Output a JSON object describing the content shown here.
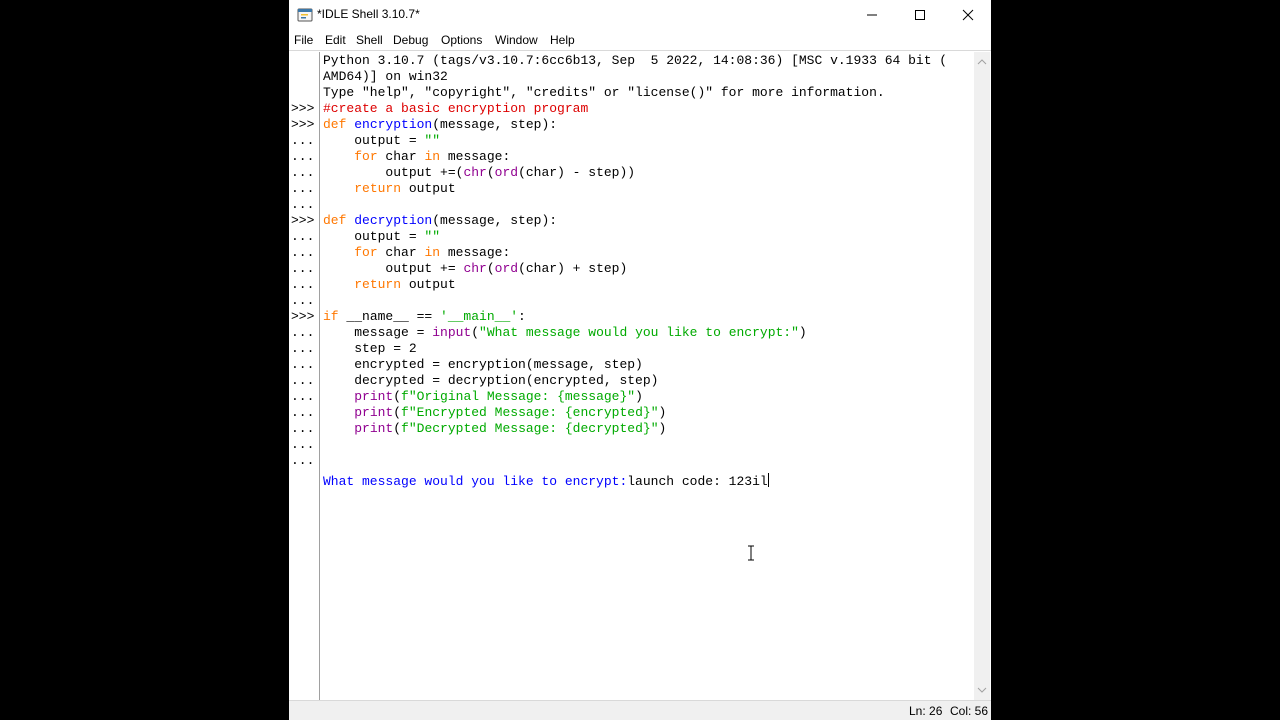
{
  "window": {
    "title": "*IDLE Shell 3.10.7*",
    "controls": [
      "minimize",
      "maximize",
      "close"
    ]
  },
  "menu": [
    "File",
    "Edit",
    "Shell",
    "Debug",
    "Options",
    "Window",
    "Help"
  ],
  "shell": {
    "banner": [
      "Python 3.10.7 (tags/v3.10.7:6cc6b13, Sep  5 2022, 14:08:36) [MSC v.1933 64 bit (",
      "AMD64)] on win32",
      "Type \"help\", \"copyright\", \"credits\" or \"license()\" for more information."
    ],
    "prompts": [
      ">>>",
      ">>>",
      "...",
      "...",
      "...",
      "...",
      "...",
      ">>>",
      "...",
      "...",
      "...",
      "...",
      "...",
      ">>>",
      "...",
      "...",
      "...",
      "...",
      "...",
      "...",
      "...",
      "...",
      "..."
    ],
    "code_lines": [
      [
        {
          "t": "#create a basic encryption program",
          "c": "cm"
        }
      ],
      [
        {
          "t": "def ",
          "c": "kw"
        },
        {
          "t": "encryption",
          "c": "def"
        },
        {
          "t": "(message, step):",
          "c": "plain"
        }
      ],
      [
        {
          "t": "    output = ",
          "c": "plain"
        },
        {
          "t": "\"\"",
          "c": "str"
        }
      ],
      [
        {
          "t": "    ",
          "c": "plain"
        },
        {
          "t": "for",
          "c": "kw"
        },
        {
          "t": " char ",
          "c": "plain"
        },
        {
          "t": "in",
          "c": "kw"
        },
        {
          "t": " message:",
          "c": "plain"
        }
      ],
      [
        {
          "t": "        output +=(",
          "c": "plain"
        },
        {
          "t": "chr",
          "c": "bi"
        },
        {
          "t": "(",
          "c": "plain"
        },
        {
          "t": "ord",
          "c": "bi"
        },
        {
          "t": "(char) - step))",
          "c": "plain"
        }
      ],
      [
        {
          "t": "    ",
          "c": "plain"
        },
        {
          "t": "return",
          "c": "kw"
        },
        {
          "t": " output",
          "c": "plain"
        }
      ],
      [
        {
          "t": "",
          "c": "plain"
        }
      ],
      [
        {
          "t": "def ",
          "c": "kw"
        },
        {
          "t": "decryption",
          "c": "def"
        },
        {
          "t": "(message, step):",
          "c": "plain"
        }
      ],
      [
        {
          "t": "    output = ",
          "c": "plain"
        },
        {
          "t": "\"\"",
          "c": "str"
        }
      ],
      [
        {
          "t": "    ",
          "c": "plain"
        },
        {
          "t": "for",
          "c": "kw"
        },
        {
          "t": " char ",
          "c": "plain"
        },
        {
          "t": "in",
          "c": "kw"
        },
        {
          "t": " message:",
          "c": "plain"
        }
      ],
      [
        {
          "t": "        output += ",
          "c": "plain"
        },
        {
          "t": "chr",
          "c": "bi"
        },
        {
          "t": "(",
          "c": "plain"
        },
        {
          "t": "ord",
          "c": "bi"
        },
        {
          "t": "(char) + step)",
          "c": "plain"
        }
      ],
      [
        {
          "t": "    ",
          "c": "plain"
        },
        {
          "t": "return",
          "c": "kw"
        },
        {
          "t": " output",
          "c": "plain"
        }
      ],
      [
        {
          "t": "",
          "c": "plain"
        }
      ],
      [
        {
          "t": "if",
          "c": "kw"
        },
        {
          "t": " __name__ == ",
          "c": "plain"
        },
        {
          "t": "'__main__'",
          "c": "str"
        },
        {
          "t": ":",
          "c": "plain"
        }
      ],
      [
        {
          "t": "    message = ",
          "c": "plain"
        },
        {
          "t": "input",
          "c": "bi"
        },
        {
          "t": "(",
          "c": "plain"
        },
        {
          "t": "\"What message would you like to encrypt:\"",
          "c": "str"
        },
        {
          "t": ")",
          "c": "plain"
        }
      ],
      [
        {
          "t": "    step = 2",
          "c": "plain"
        }
      ],
      [
        {
          "t": "    encrypted = encryption(message, step)",
          "c": "plain"
        }
      ],
      [
        {
          "t": "    decrypted = decryption(encrypted, step)",
          "c": "plain"
        }
      ],
      [
        {
          "t": "    ",
          "c": "plain"
        },
        {
          "t": "print",
          "c": "bi"
        },
        {
          "t": "(",
          "c": "plain"
        },
        {
          "t": "f\"Original Message: {message}\"",
          "c": "str"
        },
        {
          "t": ")",
          "c": "plain"
        }
      ],
      [
        {
          "t": "    ",
          "c": "plain"
        },
        {
          "t": "print",
          "c": "bi"
        },
        {
          "t": "(",
          "c": "plain"
        },
        {
          "t": "f\"Encrypted Message: {encrypted}\"",
          "c": "str"
        },
        {
          "t": ")",
          "c": "plain"
        }
      ],
      [
        {
          "t": "    ",
          "c": "plain"
        },
        {
          "t": "print",
          "c": "bi"
        },
        {
          "t": "(",
          "c": "plain"
        },
        {
          "t": "f\"Decrypted Message: {decrypted}\"",
          "c": "str"
        },
        {
          "t": ")",
          "c": "plain"
        }
      ],
      [
        {
          "t": "",
          "c": "plain"
        }
      ],
      [
        {
          "t": "",
          "c": "plain"
        }
      ]
    ],
    "output_prompt": "What message would you like to encrypt:",
    "user_input": "launch code: 123il"
  },
  "status": {
    "ln": "Ln: 26",
    "col": "Col: 56"
  },
  "colors": {
    "keyword": "#ff7700",
    "definition": "#0000ff",
    "builtin": "#900090",
    "string": "#00aa00",
    "comment": "#dd0000",
    "stdout": "#0000ff"
  }
}
